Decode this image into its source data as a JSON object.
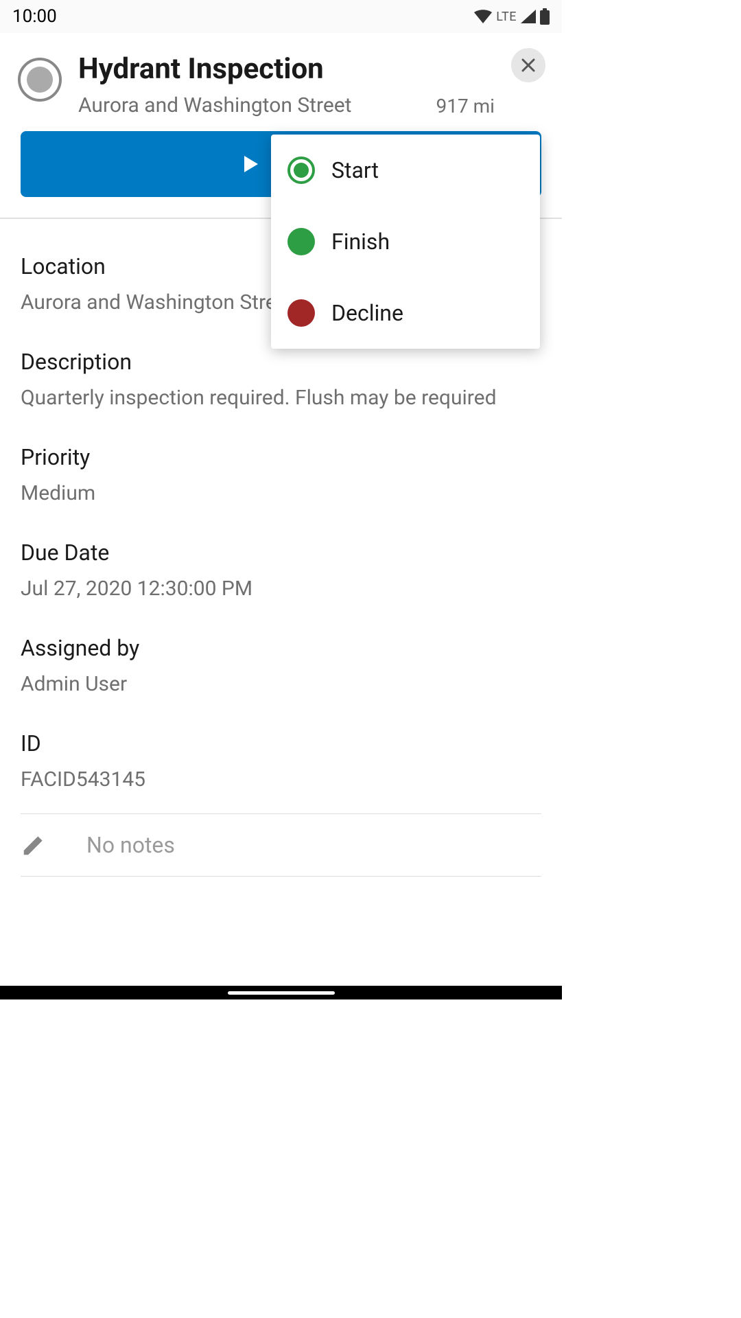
{
  "status_bar": {
    "time": "10:00",
    "network": "LTE"
  },
  "header": {
    "title": "Hydrant Inspection",
    "subtitle": "Aurora and Washington Street",
    "distance": "917 mi"
  },
  "primary_button": {
    "label": "Start"
  },
  "fields": {
    "location": {
      "label": "Location",
      "value": "Aurora and Washington Street"
    },
    "description": {
      "label": "Description",
      "value": "Quarterly inspection required. Flush may be required"
    },
    "priority": {
      "label": "Priority",
      "value": "Medium"
    },
    "due_date": {
      "label": "Due Date",
      "value": "Jul 27, 2020 12:30:00 PM"
    },
    "assigned_by": {
      "label": "Assigned by",
      "value": "Admin User"
    },
    "id": {
      "label": "ID",
      "value": "FACID543145"
    }
  },
  "notes": {
    "placeholder": "No notes"
  },
  "popup": {
    "start": "Start",
    "finish": "Finish",
    "decline": "Decline"
  }
}
